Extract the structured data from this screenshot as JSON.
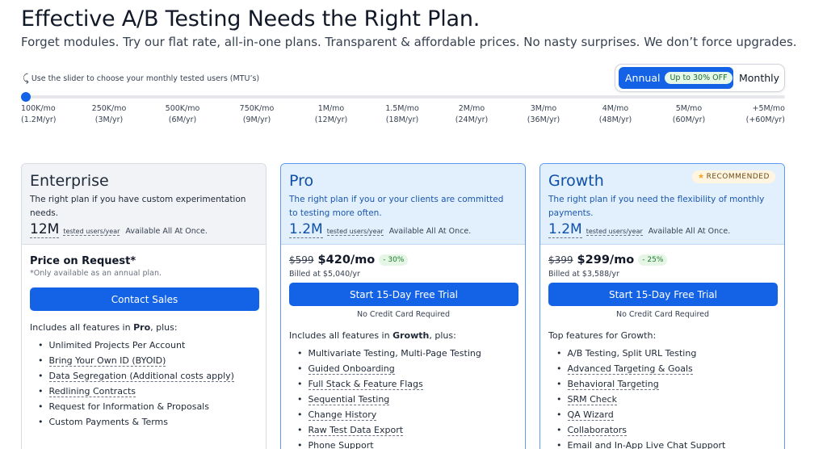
{
  "hero": {
    "title": "Effective A/B Testing Needs the Right Plan.",
    "subtitle": "Forget modules. Try our flat rate, all-in-one plans. Transparent & affordable prices. No nasty surprises. We don’t force upgrades."
  },
  "slider": {
    "hint": "Use the slider to choose your monthly tested users (MTU’s)",
    "selected_fraction": 0,
    "ticks": [
      {
        "monthly": "100K/mo",
        "yearly": "(1.2M/yr)"
      },
      {
        "monthly": "250K/mo",
        "yearly": "(3M/yr)"
      },
      {
        "monthly": "500K/mo",
        "yearly": "(6M/yr)"
      },
      {
        "monthly": "750K/mo",
        "yearly": "(9M/yr)"
      },
      {
        "monthly": "1M/mo",
        "yearly": "(12M/yr)"
      },
      {
        "monthly": "1.5M/mo",
        "yearly": "(18M/yr)"
      },
      {
        "monthly": "2M/mo",
        "yearly": "(24M/yr)"
      },
      {
        "monthly": "3M/mo",
        "yearly": "(36M/yr)"
      },
      {
        "monthly": "4M/mo",
        "yearly": "(48M/yr)"
      },
      {
        "monthly": "5M/mo",
        "yearly": "(60M/yr)"
      },
      {
        "monthly": "+5M/mo",
        "yearly": "(+60M/yr)"
      }
    ]
  },
  "billing": {
    "annual_label": "Annual",
    "annual_badge": "Up to 30% OFF",
    "monthly_label": "Monthly",
    "selected": "Annual"
  },
  "plans": [
    {
      "name": "Enterprise",
      "description": "The right plan if you have custom experimentation needs.",
      "mtu": "12M",
      "mtu_unit": "tested users/year",
      "availability": "Available All At Once.",
      "price_label": "Price on Request*",
      "price_note": "*Only available as an annual plan.",
      "cta": "Contact Sales",
      "features_prefix": "Includes all features in ",
      "features_plan": "Pro",
      "features_suffix": ", plus:",
      "features": [
        "Unlimited Projects Per Account",
        "Bring Your Own ID (BYOID)",
        "Data Segregation (Additional costs apply)",
        "Redlining Contracts",
        "Request for Information & Proposals",
        "Custom Payments & Terms"
      ]
    },
    {
      "name": "Pro",
      "description": "The right plan if you or your clients are committed to testing more often.",
      "mtu": "1.2M",
      "mtu_unit": "tested users/year",
      "availability": "Available All At Once.",
      "old_price": "$599",
      "new_price": "$420/mo",
      "discount": "- 30%",
      "billed": "Billed at $5,040/yr",
      "cta": "Start 15-Day Free Trial",
      "cta_note": "No Credit Card Required",
      "features_prefix": "Includes all features in ",
      "features_plan": "Growth",
      "features_suffix": ", plus:",
      "features": [
        "Multivariate Testing, Multi-Page Testing",
        "Guided Onboarding",
        "Full Stack & Feature Flags",
        "Sequential Testing",
        "Change History",
        "Raw Test Data Export",
        "Phone Support"
      ]
    },
    {
      "name": "Growth",
      "badge": "RECOMMENDED",
      "description": "The right plan if you need the flexibility of monthly payments.",
      "mtu": "1.2M",
      "mtu_unit": "tested users/year",
      "availability": "Available All At Once.",
      "old_price": "$399",
      "new_price": "$299/mo",
      "discount": "- 25%",
      "billed": "Billed at $3,588/yr",
      "cta": "Start 15-Day Free Trial",
      "cta_note": "No Credit Card Required",
      "features_heading": "Top features for Growth:",
      "features": [
        "A/B Testing, Split URL Testing",
        "Advanced Targeting & Goals",
        "Behavioral Targeting",
        "SRM Check",
        "QA Wizard",
        "Collaborators",
        "Email and In-App Live Chat Support"
      ]
    }
  ]
}
